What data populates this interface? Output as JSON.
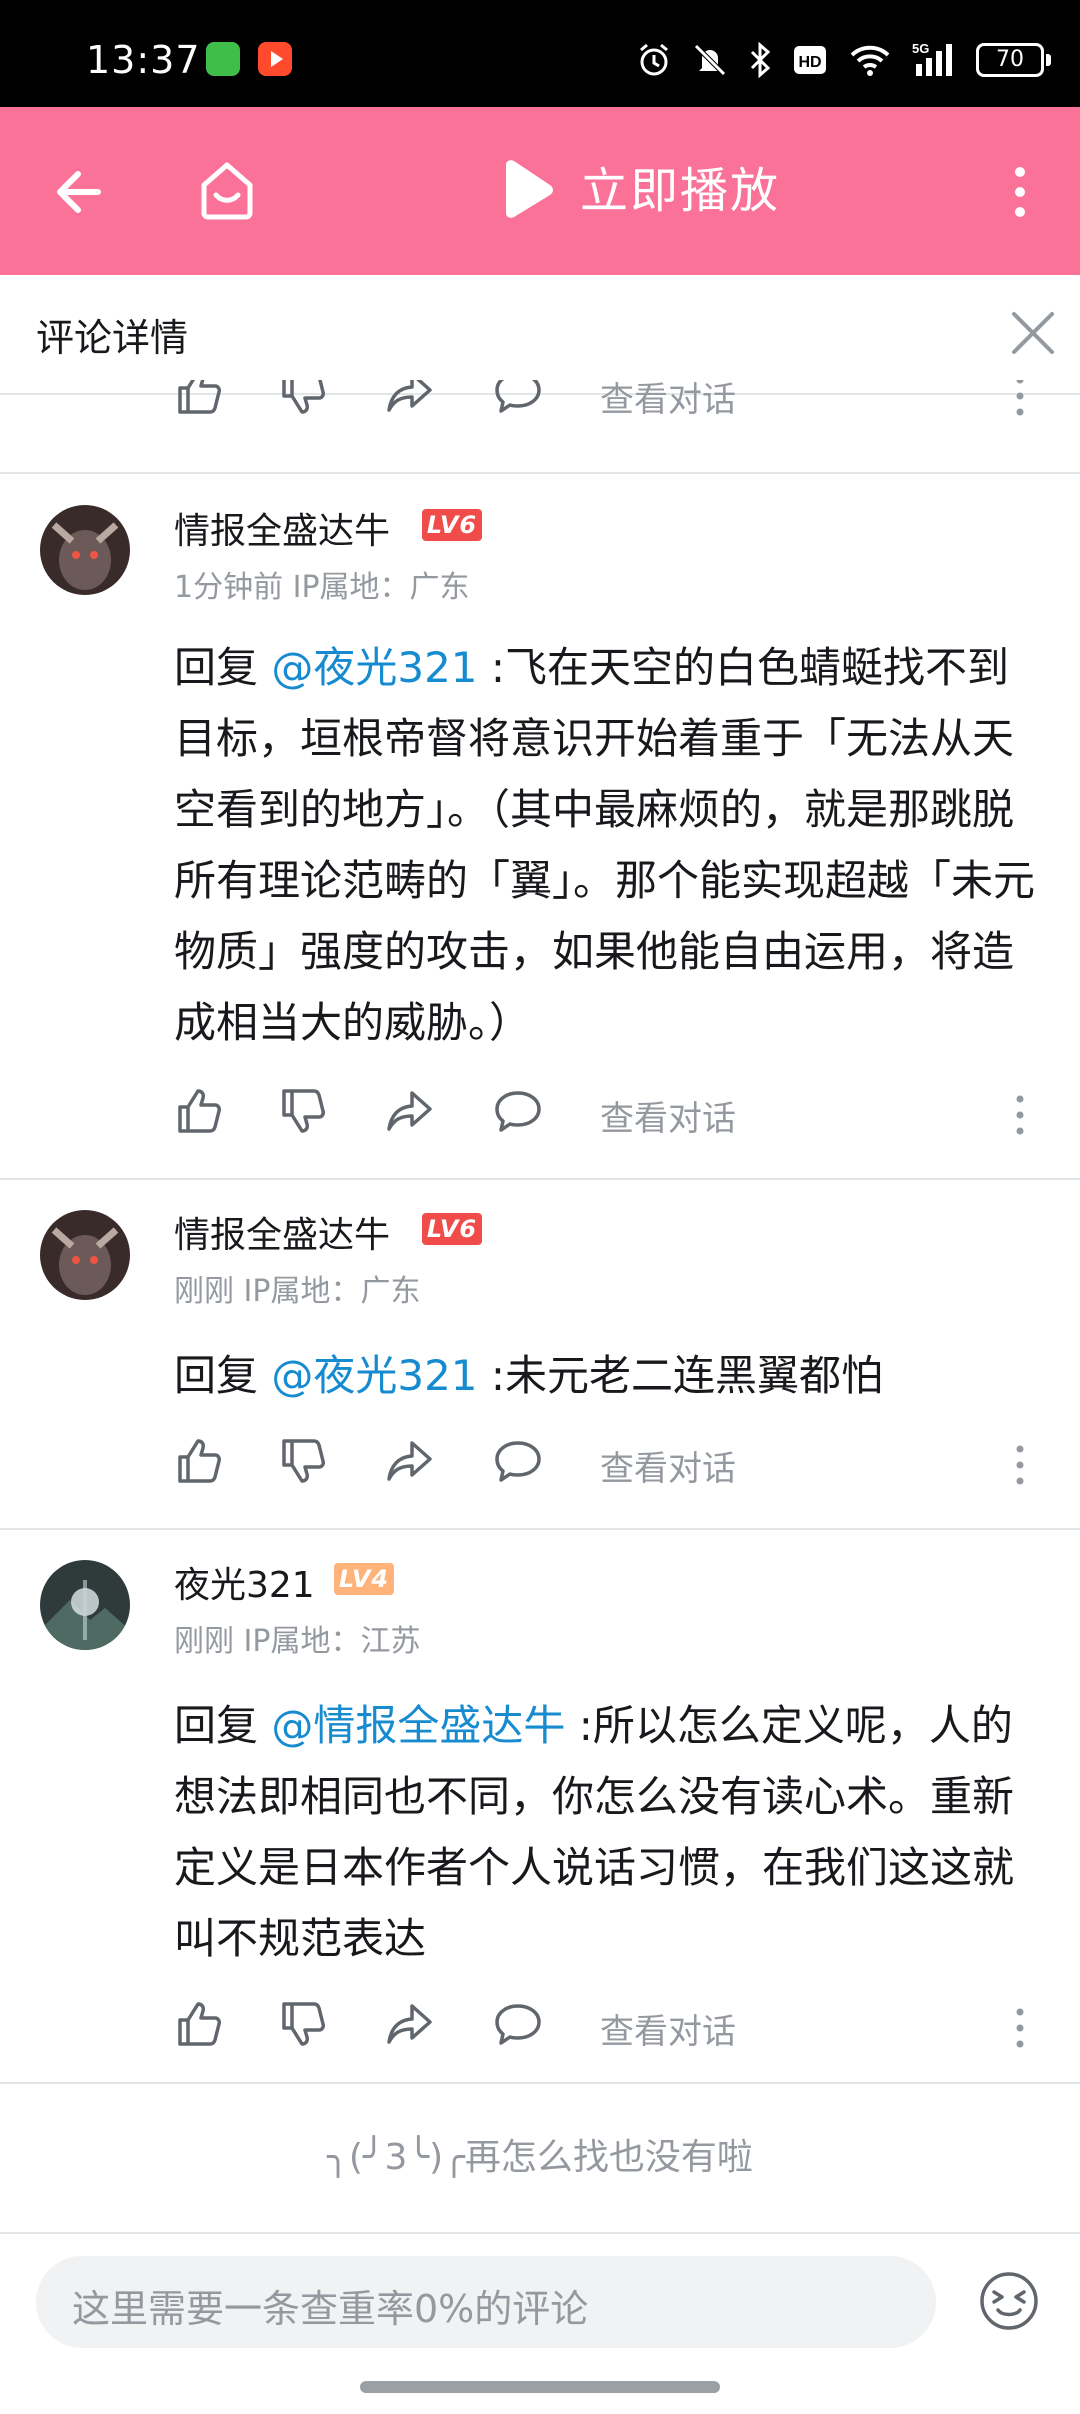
{
  "status_bar": {
    "time": "13:37",
    "network": "5G",
    "battery": "70",
    "icons": [
      "alarm-icon",
      "mute-icon",
      "bluetooth-icon",
      "hd-icon",
      "wifi-icon",
      "signal-icon",
      "battery-icon"
    ]
  },
  "nav": {
    "title": "立即播放",
    "accent": "#fb7299"
  },
  "detail": {
    "title": "评论详情"
  },
  "actions": {
    "view_conversation": "查看对话"
  },
  "comments": [
    {
      "username": "情报全盛达牛",
      "level": "LV6",
      "meta": "1分钟前 IP属地：广东",
      "reply_prefix": "回复 ",
      "mention": "@夜光321",
      "text": " :飞在天空的白色蜻蜓找不到目标，垣根帝督将意识开始着重于「无法从天空看到的地方」。（其中最麻烦的，就是那跳脱所有理论范畴的「翼」。那个能实现超越「未元物质」强度的攻击，如果他能自由运用，将造成相当大的威胁。）"
    },
    {
      "username": "情报全盛达牛",
      "level": "LV6",
      "meta": "刚刚 IP属地：广东",
      "reply_prefix": "回复 ",
      "mention": "@夜光321",
      "text": " :未元老二连黑翼都怕"
    },
    {
      "username": "夜光321",
      "level": "LV4",
      "meta": "刚刚 IP属地：江苏",
      "reply_prefix": "回复 ",
      "mention": "@情报全盛达牛",
      "text": " :所以怎么定义呢，人的想法即相同也不同，你怎么没有读心术。重新定义是日本作者个人说话习惯，在我们这这就叫不规范表达"
    }
  ],
  "end_text": "╮(╯3╰)╭再怎么找也没有啦",
  "input": {
    "placeholder": "这里需要一条查重率0%的评论"
  }
}
